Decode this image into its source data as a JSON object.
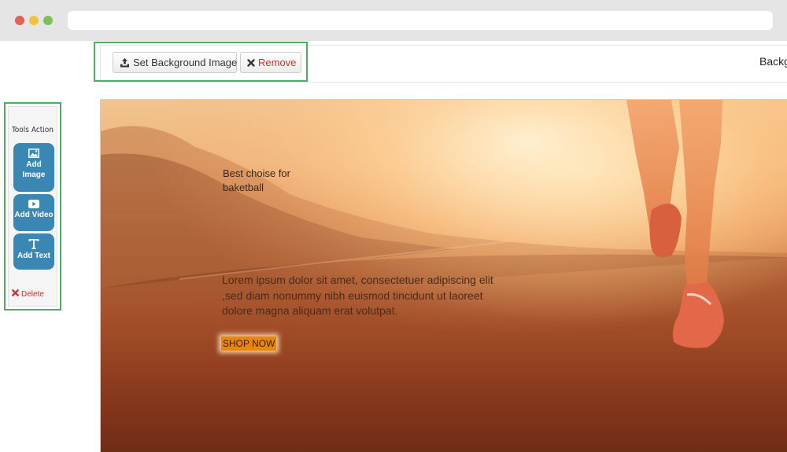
{
  "toolbar": {
    "set_background_label": "Set Background Image",
    "remove_label": "Remove",
    "background_label": "Background"
  },
  "tools_panel": {
    "title": "Tools Action",
    "add_image_line1": "Add",
    "add_image_line2": "Image",
    "add_video_label": "Add Video",
    "add_text_label": "Add Text",
    "delete_label": "Delete"
  },
  "canvas": {
    "headline": "Best choise for baketball",
    "body": "Lorem ipsum dolor sit amet, consectetuer adipiscing elit ,sed diam nonummy nibh euismod tincidunt ut laoreet dolore magna aliquam erat volutpat.",
    "cta_label": "SHOP NOW"
  },
  "colors": {
    "highlight_border": "#4caf60",
    "tool_button": "#3b87b3",
    "remove_red": "#c9302c",
    "cta_orange": "#e8870e"
  },
  "icons": {
    "upload": "upload-icon",
    "remove": "close-icon",
    "image": "image-icon",
    "video": "video-play-icon",
    "text": "text-icon",
    "delete": "close-icon"
  }
}
